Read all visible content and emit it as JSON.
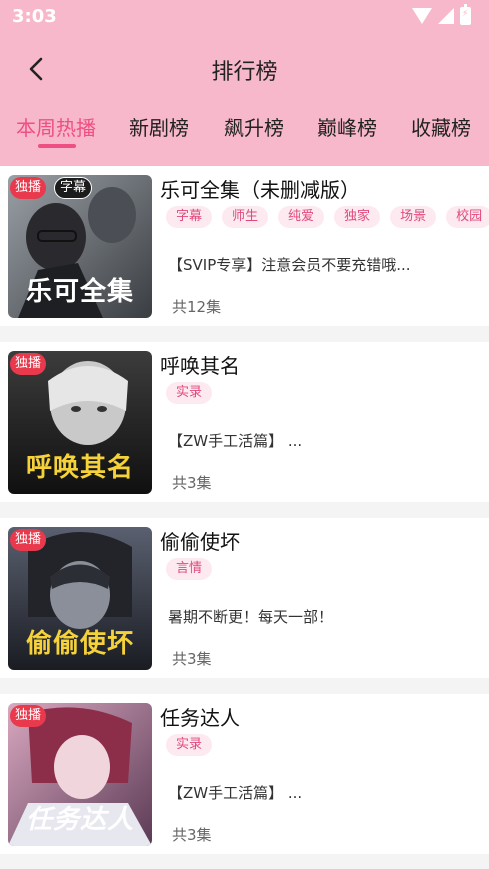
{
  "status_bar": {
    "time": "3:03"
  },
  "nav": {
    "title": "排行榜"
  },
  "tabs": [
    {
      "label": "本周热播",
      "active": true
    },
    {
      "label": "新剧榜",
      "active": false
    },
    {
      "label": "飙升榜",
      "active": false
    },
    {
      "label": "巅峰榜",
      "active": false
    },
    {
      "label": "收藏榜",
      "active": false
    }
  ],
  "items": [
    {
      "title": "乐可全集（未删减版）",
      "badges": [
        "独播",
        "字幕"
      ],
      "cover_text": "乐可全集",
      "tags": [
        "字幕",
        "师生",
        "纯爱",
        "独家",
        "场景",
        "校园"
      ],
      "description": "【SVIP专享】注意会员不要充错哦...",
      "episodes": "共12集"
    },
    {
      "title": "呼唤其名",
      "badges": [
        "独播"
      ],
      "cover_text": "呼唤其名",
      "tags": [
        "实录"
      ],
      "description": "【ZW手工活篇】 ...",
      "episodes": "共3集"
    },
    {
      "title": "偷偷使坏",
      "badges": [
        "独播"
      ],
      "cover_text": "偷偷使坏",
      "tags": [
        "言情"
      ],
      "description": "暑期不断更！每天一部！",
      "episodes": "共3集"
    },
    {
      "title": "任务达人",
      "badges": [
        "独播"
      ],
      "cover_text": "任务达人",
      "tags": [
        "实录"
      ],
      "description": "【ZW手工活篇】 ...",
      "episodes": "共3集"
    }
  ],
  "colors": {
    "header": "#f7b8cb",
    "accent": "#ee4f84",
    "tag_bg": "#fdeaf0",
    "badge_red": "#e8394d"
  },
  "icons": {
    "back": "chevron-left-icon",
    "wifi": "wifi-icon",
    "signal": "signal-icon",
    "battery": "battery-charging-icon"
  }
}
